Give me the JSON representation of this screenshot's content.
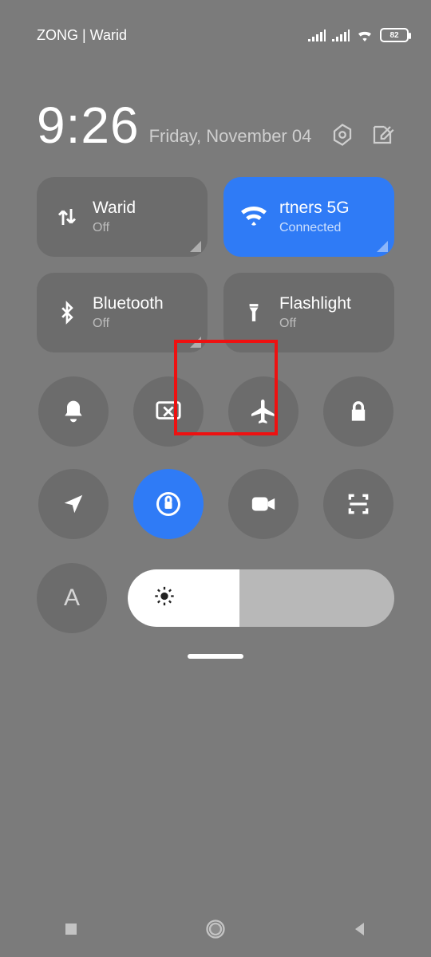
{
  "status": {
    "carrier": "ZONG | Warid",
    "battery_pct": "82"
  },
  "clock": {
    "time": "9:26",
    "date": "Friday, November 04"
  },
  "tiles": {
    "data": {
      "title": "Warid",
      "sub": "Off"
    },
    "wifi": {
      "title": "rtners 5G",
      "sub": "Connected"
    },
    "bluetooth": {
      "title": "Bluetooth",
      "sub": "Off"
    },
    "flashlight": {
      "title": "Flashlight",
      "sub": "Off"
    }
  },
  "brightness": {
    "auto_label": "A",
    "percent": 42
  },
  "highlighted_toggle": "airplane"
}
